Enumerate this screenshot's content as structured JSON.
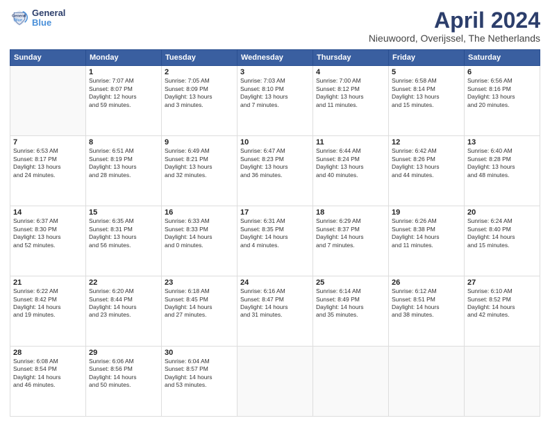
{
  "logo": {
    "line1": "General",
    "line2": "Blue"
  },
  "title": "April 2024",
  "subtitle": "Nieuwoord, Overijssel, The Netherlands",
  "weekdays": [
    "Sunday",
    "Monday",
    "Tuesday",
    "Wednesday",
    "Thursday",
    "Friday",
    "Saturday"
  ],
  "weeks": [
    [
      {
        "day": "",
        "info": ""
      },
      {
        "day": "1",
        "info": "Sunrise: 7:07 AM\nSunset: 8:07 PM\nDaylight: 12 hours\nand 59 minutes."
      },
      {
        "day": "2",
        "info": "Sunrise: 7:05 AM\nSunset: 8:09 PM\nDaylight: 13 hours\nand 3 minutes."
      },
      {
        "day": "3",
        "info": "Sunrise: 7:03 AM\nSunset: 8:10 PM\nDaylight: 13 hours\nand 7 minutes."
      },
      {
        "day": "4",
        "info": "Sunrise: 7:00 AM\nSunset: 8:12 PM\nDaylight: 13 hours\nand 11 minutes."
      },
      {
        "day": "5",
        "info": "Sunrise: 6:58 AM\nSunset: 8:14 PM\nDaylight: 13 hours\nand 15 minutes."
      },
      {
        "day": "6",
        "info": "Sunrise: 6:56 AM\nSunset: 8:16 PM\nDaylight: 13 hours\nand 20 minutes."
      }
    ],
    [
      {
        "day": "7",
        "info": "Sunrise: 6:53 AM\nSunset: 8:17 PM\nDaylight: 13 hours\nand 24 minutes."
      },
      {
        "day": "8",
        "info": "Sunrise: 6:51 AM\nSunset: 8:19 PM\nDaylight: 13 hours\nand 28 minutes."
      },
      {
        "day": "9",
        "info": "Sunrise: 6:49 AM\nSunset: 8:21 PM\nDaylight: 13 hours\nand 32 minutes."
      },
      {
        "day": "10",
        "info": "Sunrise: 6:47 AM\nSunset: 8:23 PM\nDaylight: 13 hours\nand 36 minutes."
      },
      {
        "day": "11",
        "info": "Sunrise: 6:44 AM\nSunset: 8:24 PM\nDaylight: 13 hours\nand 40 minutes."
      },
      {
        "day": "12",
        "info": "Sunrise: 6:42 AM\nSunset: 8:26 PM\nDaylight: 13 hours\nand 44 minutes."
      },
      {
        "day": "13",
        "info": "Sunrise: 6:40 AM\nSunset: 8:28 PM\nDaylight: 13 hours\nand 48 minutes."
      }
    ],
    [
      {
        "day": "14",
        "info": "Sunrise: 6:37 AM\nSunset: 8:30 PM\nDaylight: 13 hours\nand 52 minutes."
      },
      {
        "day": "15",
        "info": "Sunrise: 6:35 AM\nSunset: 8:31 PM\nDaylight: 13 hours\nand 56 minutes."
      },
      {
        "day": "16",
        "info": "Sunrise: 6:33 AM\nSunset: 8:33 PM\nDaylight: 14 hours\nand 0 minutes."
      },
      {
        "day": "17",
        "info": "Sunrise: 6:31 AM\nSunset: 8:35 PM\nDaylight: 14 hours\nand 4 minutes."
      },
      {
        "day": "18",
        "info": "Sunrise: 6:29 AM\nSunset: 8:37 PM\nDaylight: 14 hours\nand 7 minutes."
      },
      {
        "day": "19",
        "info": "Sunrise: 6:26 AM\nSunset: 8:38 PM\nDaylight: 14 hours\nand 11 minutes."
      },
      {
        "day": "20",
        "info": "Sunrise: 6:24 AM\nSunset: 8:40 PM\nDaylight: 14 hours\nand 15 minutes."
      }
    ],
    [
      {
        "day": "21",
        "info": "Sunrise: 6:22 AM\nSunset: 8:42 PM\nDaylight: 14 hours\nand 19 minutes."
      },
      {
        "day": "22",
        "info": "Sunrise: 6:20 AM\nSunset: 8:44 PM\nDaylight: 14 hours\nand 23 minutes."
      },
      {
        "day": "23",
        "info": "Sunrise: 6:18 AM\nSunset: 8:45 PM\nDaylight: 14 hours\nand 27 minutes."
      },
      {
        "day": "24",
        "info": "Sunrise: 6:16 AM\nSunset: 8:47 PM\nDaylight: 14 hours\nand 31 minutes."
      },
      {
        "day": "25",
        "info": "Sunrise: 6:14 AM\nSunset: 8:49 PM\nDaylight: 14 hours\nand 35 minutes."
      },
      {
        "day": "26",
        "info": "Sunrise: 6:12 AM\nSunset: 8:51 PM\nDaylight: 14 hours\nand 38 minutes."
      },
      {
        "day": "27",
        "info": "Sunrise: 6:10 AM\nSunset: 8:52 PM\nDaylight: 14 hours\nand 42 minutes."
      }
    ],
    [
      {
        "day": "28",
        "info": "Sunrise: 6:08 AM\nSunset: 8:54 PM\nDaylight: 14 hours\nand 46 minutes."
      },
      {
        "day": "29",
        "info": "Sunrise: 6:06 AM\nSunset: 8:56 PM\nDaylight: 14 hours\nand 50 minutes."
      },
      {
        "day": "30",
        "info": "Sunrise: 6:04 AM\nSunset: 8:57 PM\nDaylight: 14 hours\nand 53 minutes."
      },
      {
        "day": "",
        "info": ""
      },
      {
        "day": "",
        "info": ""
      },
      {
        "day": "",
        "info": ""
      },
      {
        "day": "",
        "info": ""
      }
    ]
  ]
}
